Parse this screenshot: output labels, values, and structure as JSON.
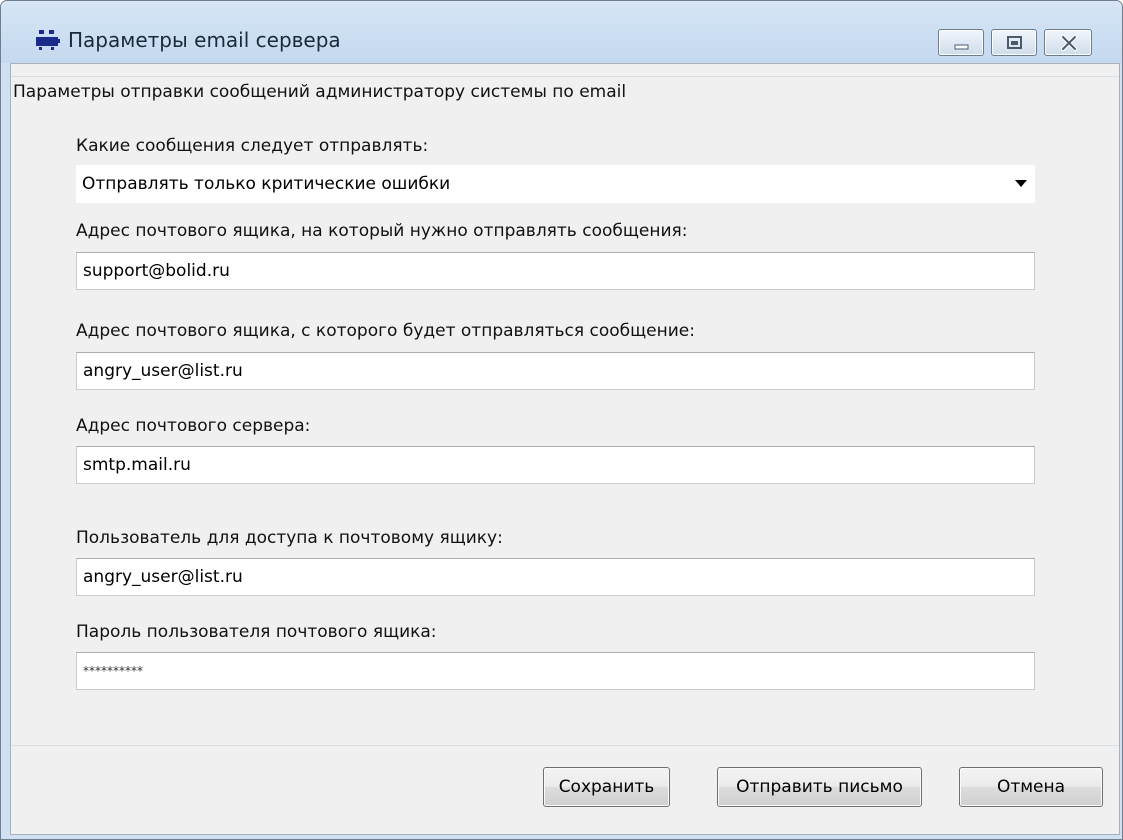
{
  "window": {
    "title": "Параметры email сервера"
  },
  "group": {
    "legend": "Параметры отправки сообщений администратору системы по email"
  },
  "message_type": {
    "label": "Какие сообщения следует отправлять:",
    "selected": "Отправлять только критические ошибки"
  },
  "recipient": {
    "label": "Адрес почтового ящика, на который нужно отправлять сообщения:",
    "value": "support@bolid.ru"
  },
  "sender": {
    "label": "Адрес почтового ящика, с которого будет отправляться сообщение:",
    "value": "angry_user@list.ru"
  },
  "server": {
    "label": "Адрес почтового сервера:",
    "value": "smtp.mail.ru"
  },
  "user": {
    "label": "Пользователь для доступа к почтовому ящику:",
    "value": "angry_user@list.ru"
  },
  "password": {
    "label": "Пароль пользователя почтового ящика:",
    "value": "**********"
  },
  "buttons": {
    "save": "Сохранить",
    "send": "Отправить письмо",
    "cancel": "Отмена"
  },
  "icons": {
    "app": "bolid-app-icon",
    "minimize": "minimize-icon",
    "maximize": "maximize-icon",
    "close": "close-icon",
    "dropdown": "chevron-down-icon"
  },
  "colors": {
    "titlebar": "#c4d8ef",
    "client_background": "#f0f0f0",
    "app_icon": "#1c2a8c"
  }
}
